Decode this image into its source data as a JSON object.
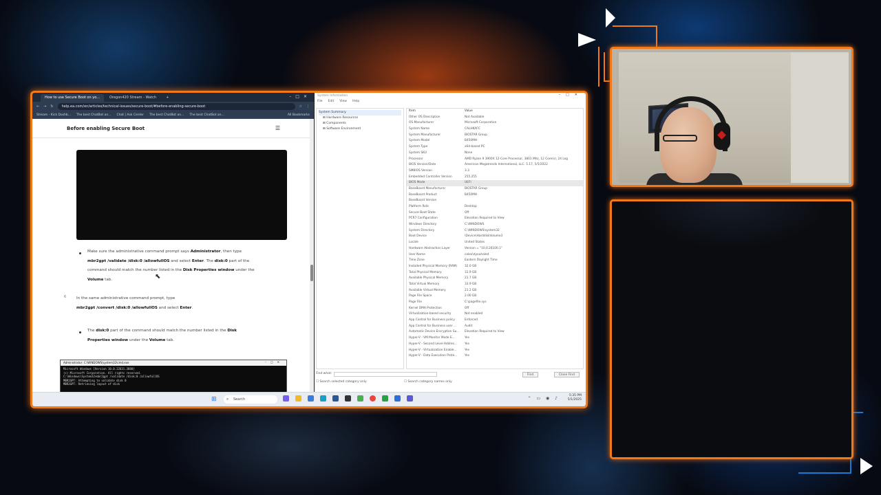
{
  "browser": {
    "tabs": [
      {
        "label": "How to use Secure Boot on yo...",
        "active": true
      },
      {
        "label": "Oregon420 Stream - Watch",
        "active": false
      }
    ],
    "url": "help.ea.com/en/articles/technical-issues/secure-boot/#before-enabling-secure-boot",
    "bookmarks": [
      "Stream - Kick Dashb...",
      "The best ChatBot an...",
      "Chat | Ask Center",
      "The best ChatBot an...",
      "The best ChatBot an...",
      "All Bookmarks"
    ]
  },
  "article": {
    "section_title": "Before enabling Secure Boot",
    "bullet1": {
      "t1": "Make sure the administrative command prompt says ",
      "b1": "Administrator",
      "t2": ", then type",
      "b2": "mbr2gpt /validate /disk:0 /allowfullOS",
      "t3": " and select ",
      "b3": "Enter",
      "t4": ". The ",
      "b4": "disk:0",
      "t5": " part of the",
      "t6": "command should match the number listed in the ",
      "b5": "Disk Properties window",
      "t7": " under the",
      "b6": "Volume",
      "t8": " tab."
    },
    "step6": {
      "number": "6",
      "t1": "In the same administrative command prompt, type",
      "b1": "mbr2gpt /convert /disk:0 /allowfullOS",
      "t2": " and select ",
      "b2": "Enter",
      "t3": "."
    },
    "bullet2": {
      "t1": "The ",
      "b1": "disk:0",
      "t2": " part of the command should match the number listed in the ",
      "b2": "Disk",
      "b3": "Properties window",
      "t3": " under the ",
      "b4": "Volume",
      "t4": " tab."
    },
    "cmd": {
      "title": "Administrator: C:\\WINDOWS\\system32\\cmd.exe",
      "lines": [
        "Microsoft Windows [Version 10.0.22631.3880]",
        "(c) Microsoft Corporation. All rights reserved.",
        "",
        "C:\\Windows\\System32>mbr2gpt /validate /disk:0 /allowfullOS",
        "MBR2GPT: Attempting to validate disk 0",
        "MBR2GPT: Retrieving layout of disk"
      ]
    }
  },
  "sysinfo": {
    "title": "System Information",
    "menu": [
      "File",
      "Edit",
      "View",
      "Help"
    ],
    "tree": [
      "System Summary",
      "Hardware Resources",
      "Components",
      "Software Environment"
    ],
    "columns": [
      "Item",
      "Value"
    ],
    "rows": [
      [
        "Other OS Description",
        "Not Available"
      ],
      [
        "OS Manufacturer",
        "Microsoft Corporation"
      ],
      [
        "System Name",
        "CALHKAFC"
      ],
      [
        "System Manufacturer",
        "BIOSTAR Group"
      ],
      [
        "System Model",
        "B450MH"
      ],
      [
        "System Type",
        "x64-based PC"
      ],
      [
        "System SKU",
        "None"
      ],
      [
        "Processor",
        "AMD Ryzen 9 3900X 12-Core Processor, 3801 Mhz, 12 Core(s), 24 Log"
      ],
      [
        "BIOS Version/Date",
        "American Megatrends International, LLC. 5.17, 5/5/2022"
      ],
      [
        "SMBIOS Version",
        "3.3"
      ],
      [
        "Embedded Controller Version",
        "255.255"
      ],
      [
        "BIOS Mode",
        "UEFI"
      ],
      [
        "BaseBoard Manufacturer",
        "BIOSTAR Group"
      ],
      [
        "BaseBoard Product",
        "B450MH"
      ],
      [
        "BaseBoard Version",
        ""
      ],
      [
        "Platform Role",
        "Desktop"
      ],
      [
        "Secure Boot State",
        "Off"
      ],
      [
        "PCR7 Configuration",
        "Elevation Required to View"
      ],
      [
        "Windows Directory",
        "C:\\WINDOWS"
      ],
      [
        "System Directory",
        "C:\\WINDOWS\\system32"
      ],
      [
        "Boot Device",
        "\\Device\\HarddiskVolume3"
      ],
      [
        "Locale",
        "United States"
      ],
      [
        "Hardware Abstraction Layer",
        "Version = \"10.0.26100.1\""
      ],
      [
        "User Name",
        "calex\\dyouhaled"
      ],
      [
        "Time Zone",
        "Eastern Daylight Time"
      ],
      [
        "Installed Physical Memory (RAM)",
        "32.0 GB"
      ],
      [
        "Total Physical Memory",
        "31.9 GB"
      ],
      [
        "Available Physical Memory",
        "21.7 GB"
      ],
      [
        "Total Virtual Memory",
        "33.9 GB"
      ],
      [
        "Available Virtual Memory",
        "21.2 GB"
      ],
      [
        "Page File Space",
        "2.00 GB"
      ],
      [
        "Page File",
        "C:\\pagefile.sys"
      ],
      [
        "Kernel DMA Protection",
        "Off"
      ],
      [
        "Virtualization-based security",
        "Not enabled"
      ],
      [
        "App Control for Business policy",
        "Enforced"
      ],
      [
        "App Control for Business user ...",
        "Audit"
      ],
      [
        "Automatic Device Encryption Su...",
        "Elevation Required to View"
      ],
      [
        "Hyper-V - VM Monitor Mode E...",
        "Yes"
      ],
      [
        "Hyper-V - Second Level Addres...",
        "Yes"
      ],
      [
        "Hyper-V - Virtualization Enable...",
        "Yes"
      ],
      [
        "Hyper-V - Data Execution Prote...",
        "Yes"
      ]
    ],
    "highlight_row": 11,
    "find_label": "Find what:",
    "find_btn": "Find",
    "close_find_btn": "Close Find",
    "search_selected": "Search selected category only",
    "search_names": "Search category names only"
  },
  "taskbar": {
    "search": "Search",
    "time": "5:35 PM",
    "date": "5/1/2025"
  },
  "colors": {
    "frame": "#f07a1a",
    "accent": "#1a73e8"
  }
}
